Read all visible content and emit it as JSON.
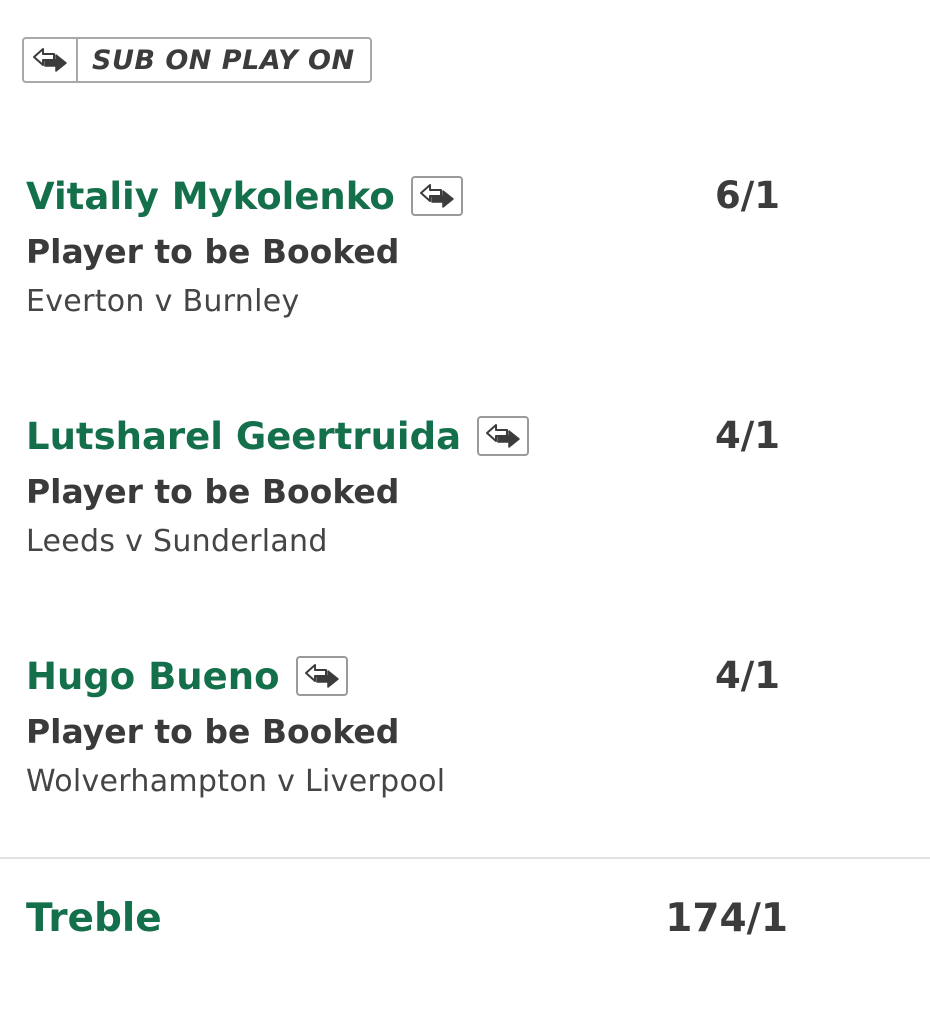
{
  "badge": {
    "icon": "swap-arrows-icon",
    "label": "SUB ON PLAY ON"
  },
  "selections": [
    {
      "player": "Vitaliy Mykolenko",
      "icon": "swap-arrows-icon",
      "odds": "6/1",
      "market": "Player to be Booked",
      "event": "Everton v Burnley"
    },
    {
      "player": "Lutsharel Geertruida",
      "icon": "swap-arrows-icon",
      "odds": "4/1",
      "market": "Player to be Booked",
      "event": "Leeds v Sunderland"
    },
    {
      "player": "Hugo Bueno",
      "icon": "swap-arrows-icon",
      "odds": "4/1",
      "market": "Player to be Booked",
      "event": "Wolverhampton v Liverpool"
    }
  ],
  "treble": {
    "label": "Treble",
    "odds": "174/1"
  },
  "colors": {
    "accent_green": "#14704a",
    "text_dark": "#3c3c3c",
    "border_grey": "#a8a8a8"
  }
}
